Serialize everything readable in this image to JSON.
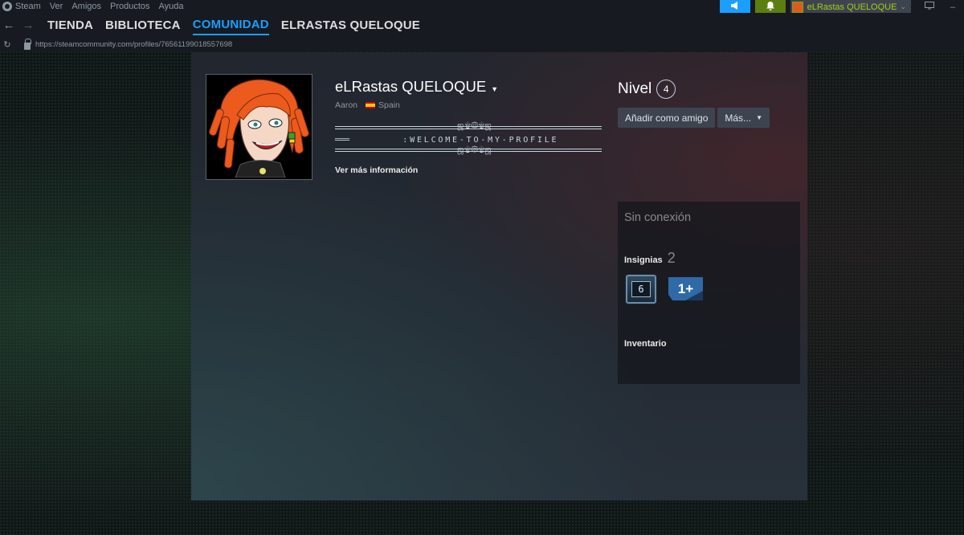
{
  "menubar": {
    "items": [
      "Steam",
      "Ver",
      "Amigos",
      "Productos",
      "Ayuda"
    ]
  },
  "account": {
    "name": "eLRastas QUELOQUE"
  },
  "nav": {
    "tabs": [
      {
        "label": "TIENDA",
        "active": false
      },
      {
        "label": "BIBLIOTECA",
        "active": false
      },
      {
        "label": "COMUNIDAD",
        "active": true
      },
      {
        "label": "ELRASTAS QUELOQUE",
        "active": false
      }
    ]
  },
  "url": "https://steamcommunity.com/profiles/76561199018557698",
  "profile": {
    "persona_name": "eLRastas QUELOQUE",
    "real_name": "Aaron",
    "country": "Spain",
    "summary_welcome": ":WELCOME-TO-MY-PROFILE",
    "more_info": "Ver más información",
    "level_label": "Nivel",
    "level": "4",
    "add_friend": "Añadir como amigo",
    "more": "Más...",
    "status": "Sin conexión",
    "badges_label": "Insignias",
    "badges_count": "2",
    "badge_years": "6",
    "badge_tier": "1+",
    "inventory_label": "Inventario"
  },
  "colors": {
    "accent": "#1a9fff",
    "notify": "#5c7e10",
    "account_name": "#a4d007"
  }
}
